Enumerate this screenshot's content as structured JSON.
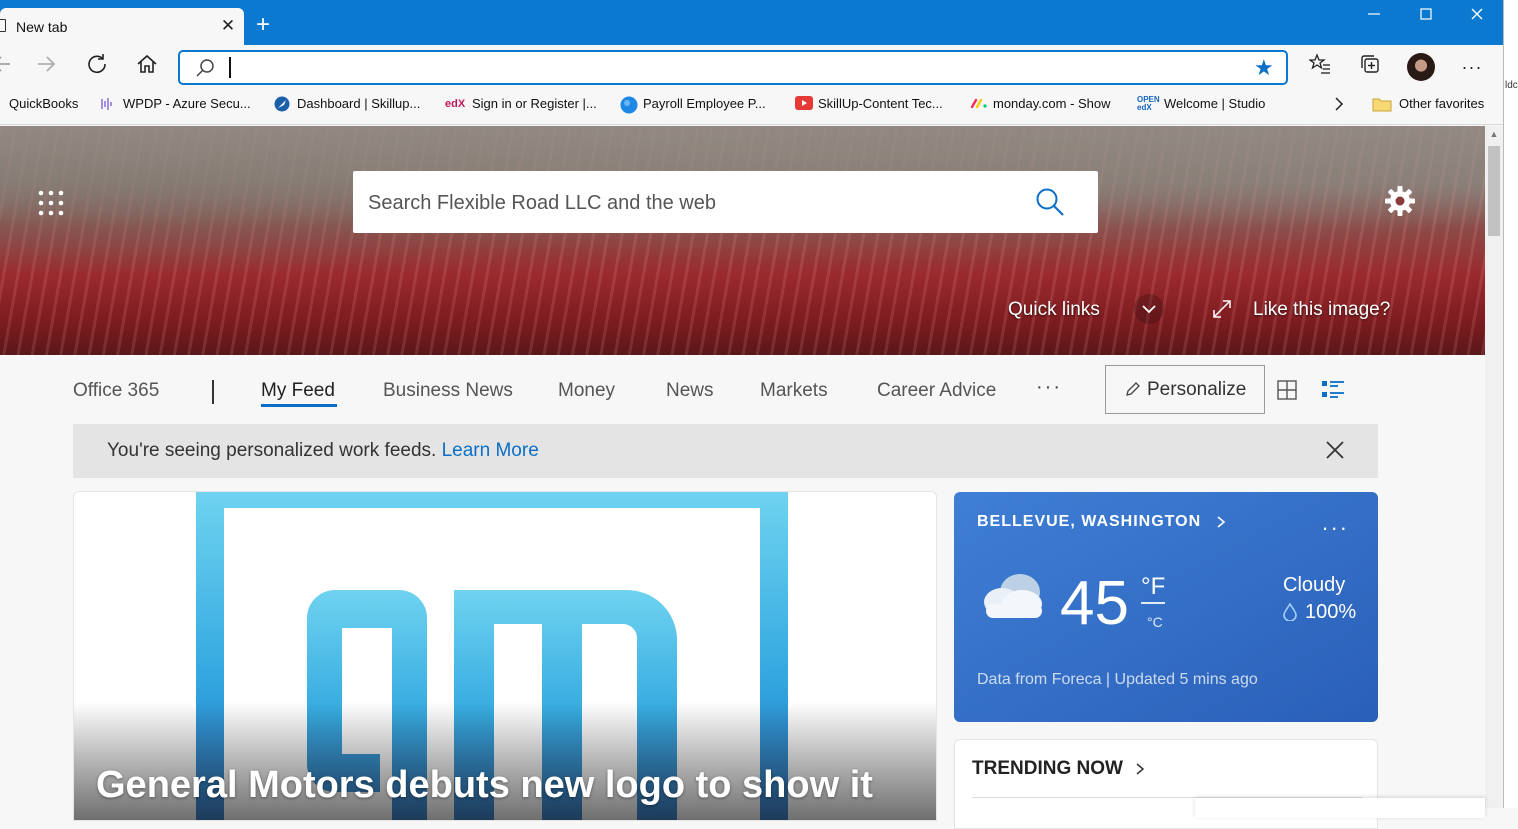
{
  "browser": {
    "tab_title": "New tab",
    "address_value": "",
    "right_strip_text": "ldc"
  },
  "favorites": {
    "items": [
      {
        "label": "QuickBooks"
      },
      {
        "label": "WPDP - Azure Secu..."
      },
      {
        "label": "Dashboard | Skillup..."
      },
      {
        "label": "Sign in or Register |..."
      },
      {
        "label": "Payroll Employee P..."
      },
      {
        "label": "SkillUp-Content Tec..."
      },
      {
        "label": "monday.com - Show"
      },
      {
        "label": "Welcome | Studio"
      }
    ],
    "other": "Other favorites"
  },
  "hero": {
    "search_placeholder": "Search Flexible Road LLC and the web",
    "quick_links": "Quick links",
    "like_image": "Like this image?"
  },
  "nav": {
    "tabs": [
      "Office 365",
      "My Feed",
      "Business News",
      "Money",
      "News",
      "Markets",
      "Career Advice"
    ],
    "more": "···",
    "personalize": "Personalize"
  },
  "notice": {
    "text": "You're seeing personalized work feeds.",
    "link": "Learn More"
  },
  "article": {
    "title": "General Motors debuts new logo to show it"
  },
  "weather": {
    "location": "BELLEVUE, WASHINGTON",
    "temperature": "45",
    "unit_f": "°F",
    "unit_c": "°C",
    "condition": "Cloudy",
    "precipitation": "100%",
    "source": "Data from Foreca | Updated 5 mins ago",
    "more": "..."
  },
  "trending": {
    "title": "TRENDING NOW"
  }
}
